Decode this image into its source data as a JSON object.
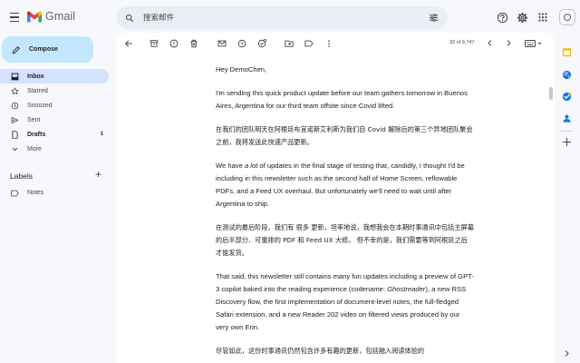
{
  "app": {
    "name": "Gmail",
    "brand_colors": [
      "#ea4335",
      "#fbbc04",
      "#34a853",
      "#4285f4"
    ]
  },
  "search": {
    "placeholder": "搜索邮件"
  },
  "compose": {
    "label": "Compose"
  },
  "sidebar": {
    "items": [
      {
        "label": "Inbox",
        "icon": "inbox-icon",
        "active": true,
        "count": ""
      },
      {
        "label": "Starred",
        "icon": "star-icon",
        "active": false,
        "count": ""
      },
      {
        "label": "Snoozed",
        "icon": "clock-icon",
        "active": false,
        "count": ""
      },
      {
        "label": "Sent",
        "icon": "send-icon",
        "active": false,
        "count": ""
      },
      {
        "label": "Drafts",
        "icon": "draft-icon",
        "active": false,
        "count": "1"
      },
      {
        "label": "More",
        "icon": "chevron-down-icon",
        "active": false,
        "count": ""
      }
    ],
    "labels_title": "Labels",
    "labels": [
      {
        "label": "Notes",
        "icon": "label-icon"
      }
    ]
  },
  "toolbar": {
    "pager": "32 of 9,747"
  },
  "email": {
    "greeting": "Hey DemoChen,",
    "p1": "I'm sending this quick product update before our team gathers tomorrow in Buenos Aires, Argentina for our third team offsite since Covid lifted.",
    "p1_zh": "在我们的团队明天在阿根廷布宜诺斯艾利斯为我们自 Covid 解除后的第三个异地团队聚会之前，我将发送此快速产品更新。",
    "p2_a": "We have ",
    "p2_em": "a lot",
    "p2_b": " of updates in the final stage of testing that, candidly, I thought I'd be including in this newsletter such as the second half of Home Screen, reflowable PDFs, and a Feed UX overhaul. But unfortunately we'll need to wait until after Argentina to ship.",
    "p2_zh": "在测试的最后阶段，我们有 很多 更新，坦率地说，我想我会在本期时事通讯中包括主屏幕的后半部分、可重排的 PDF 和 Feed UX 大修。 但不幸的是，我们需要等到阿根廷之后才能发货。",
    "p3_a": "That said, this newsletter still contains many fun updates including a preview of GPT-3 copilot baked into the reading experience (codename: ",
    "p3_em": "Ghostreader",
    "p3_b": "), a new RSS Discovery flow, the first implementation of document-level notes, the full-fledged Safari extension, and a new Reader 202 video on filtered views produced by our very own Erin.",
    "p3_zh": "尽管如此，这份时事通讯仍然包含许多有趣的更新，包括融入阅读体验的"
  },
  "rail_colors": {
    "calendar": "#fbbc04",
    "keep": "#1a73e8",
    "tasks": "#1a73e8"
  }
}
